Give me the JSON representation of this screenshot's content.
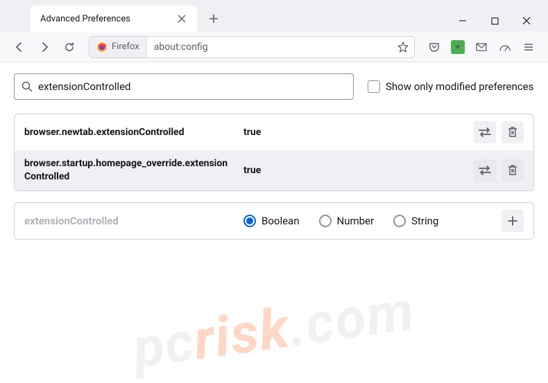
{
  "window": {
    "tab_title": "Advanced Preferences"
  },
  "urlbar": {
    "identity_label": "Firefox",
    "url": "about:config"
  },
  "search": {
    "value": "extensionControlled",
    "checkbox_label": "Show only modified preferences"
  },
  "prefs": [
    {
      "name": "browser.newtab.extensionControlled",
      "value": "true"
    },
    {
      "name": "browser.startup.homepage_override.extensionControlled",
      "value": "true"
    }
  ],
  "new_pref": {
    "name": "extensionControlled",
    "types": [
      "Boolean",
      "Number",
      "String"
    ],
    "selected": "Boolean"
  }
}
